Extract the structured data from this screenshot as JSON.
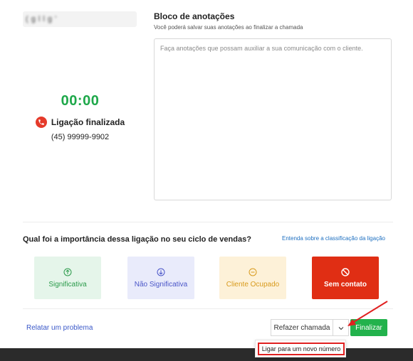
{
  "contact": {
    "name_blurred": "( g      l      l   g   '"
  },
  "call": {
    "timer": "00:00",
    "status": "Ligação finalizada",
    "phone": "(45) 99999-9902"
  },
  "notes": {
    "title": "Bloco de anotações",
    "subtitle": "Você poderá salvar suas anotações ao finalizar a chamada",
    "placeholder": "Faça anotações que possam auxiliar a sua comunicação com o cliente."
  },
  "classification": {
    "question": "Qual foi a importância dessa ligação no seu ciclo de vendas?",
    "help_link": "Entenda sobre a classificação da ligação",
    "options": [
      {
        "label": "Significativa",
        "icon": "arrow-up-circle-icon",
        "color": "#2a9a4a",
        "bg": "#e5f5ea"
      },
      {
        "label": "Não Significativa",
        "icon": "arrow-down-circle-icon",
        "color": "#4a55c8",
        "bg": "#e9ebfb"
      },
      {
        "label": "Cliente Ocupado",
        "icon": "minus-circle-icon",
        "color": "#d89a1c",
        "bg": "#fdf1d8"
      },
      {
        "label": "Sem contato",
        "icon": "ban-icon",
        "color": "#ffffff",
        "bg": "#e02e14"
      }
    ]
  },
  "footer": {
    "report_link": "Relatar um problema",
    "redo_button": "Refazer chamada",
    "finish_button": "Finalizar",
    "dropdown_item": "Ligar para um novo número"
  },
  "colors": {
    "accent_green": "#22b24c",
    "timer_green": "#1ea84a",
    "danger_red": "#e02e14",
    "link_blue": "#1d6fc0"
  }
}
